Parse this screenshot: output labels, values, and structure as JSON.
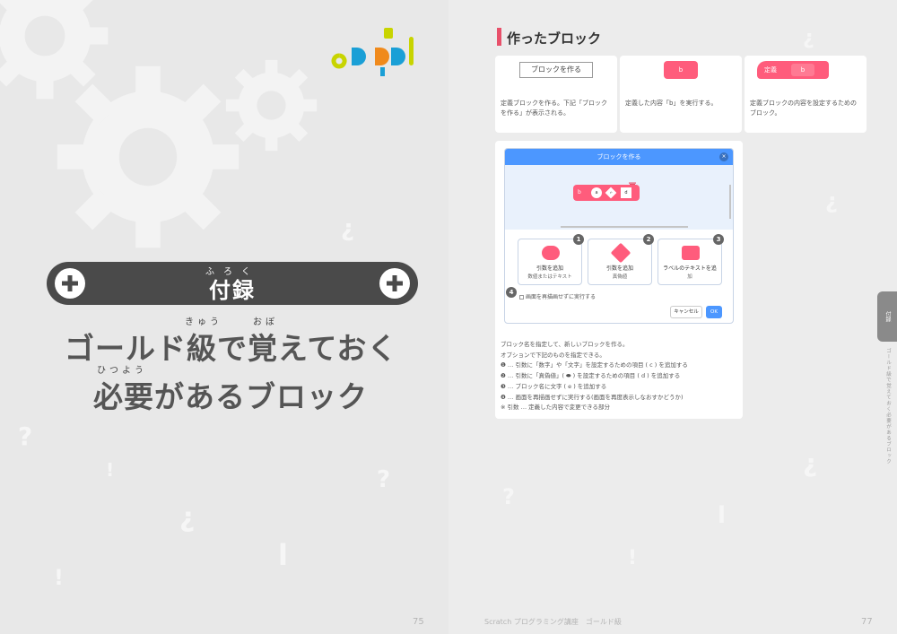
{
  "left_page": {
    "banner": {
      "ruby": "ふろく",
      "title": "付録"
    },
    "headline_line1": "ゴールド級で覚えておく",
    "headline_line1_ruby_1": "きゅう",
    "headline_line1_ruby_2": "おぼ",
    "headline_line2": "必要があるブロック",
    "headline_line2_ruby": "ひつよう",
    "page_number": "75"
  },
  "right_page": {
    "section_title": "作ったブロック",
    "cards": [
      {
        "top_label": "ブロックを作る",
        "text": "定義ブロックを作る。下記「ブロックを作る」が表示される。"
      },
      {
        "top_label": "b",
        "text": "定義した内容「b」を実行する。"
      },
      {
        "top_label": "定義",
        "top_label_2": "b",
        "text": "定義ブロックの内容を設定するためのブロック。"
      }
    ],
    "dialog": {
      "title": "ブロックを作る",
      "close": "×",
      "preview_tokens": [
        "b",
        "a",
        "c",
        "d"
      ],
      "options": [
        {
          "label": "引数を追加",
          "sub": "数値またはテキスト",
          "badge": "1"
        },
        {
          "label": "引数を追加",
          "sub": "真偽値",
          "badge": "2"
        },
        {
          "label": "ラベルのテキストを追",
          "sub": "加",
          "badge": "3"
        }
      ],
      "checkbox_badge": "4",
      "checkbox_label": "画面を再描画せずに実行する",
      "cancel": "キャンセル",
      "ok": "OK"
    },
    "notes": [
      "ブロック名を指定して、新しいブロックを作る。",
      "オプションで下記のものを指定できる。",
      "❶ … 引数に「数字」や「文字」を設定するための項目 ( c ) を追加する",
      "❷ … 引数に「真偽値」( ⬬ ) を設定するための項目 ( d ) を追加する",
      "❸ … ブロック名に文字 ( e ) を追加する",
      "❹ … 画面を再描画せずに実行する(画面を再度表示しなおすかどうか)",
      "※ 引数 … 定義した内容で変更できる部分"
    ],
    "side_tab": "付録",
    "side_vertical": "ゴールド級で覚えておく必要があるブロック",
    "footer_title": "Scratch プログラミング講座　ゴールド級",
    "page_number": "77"
  },
  "colors": {
    "accent_pink": "#ff5c7c",
    "banner_dark": "#4a4a4a",
    "scratch_blue": "#4c97ff",
    "logo_yellow": "#c8d400",
    "logo_blue": "#1a9fd6",
    "logo_orange": "#f08a1c"
  },
  "icons": [
    "plus-icon",
    "gear-icon",
    "close-icon",
    "trash-icon"
  ]
}
